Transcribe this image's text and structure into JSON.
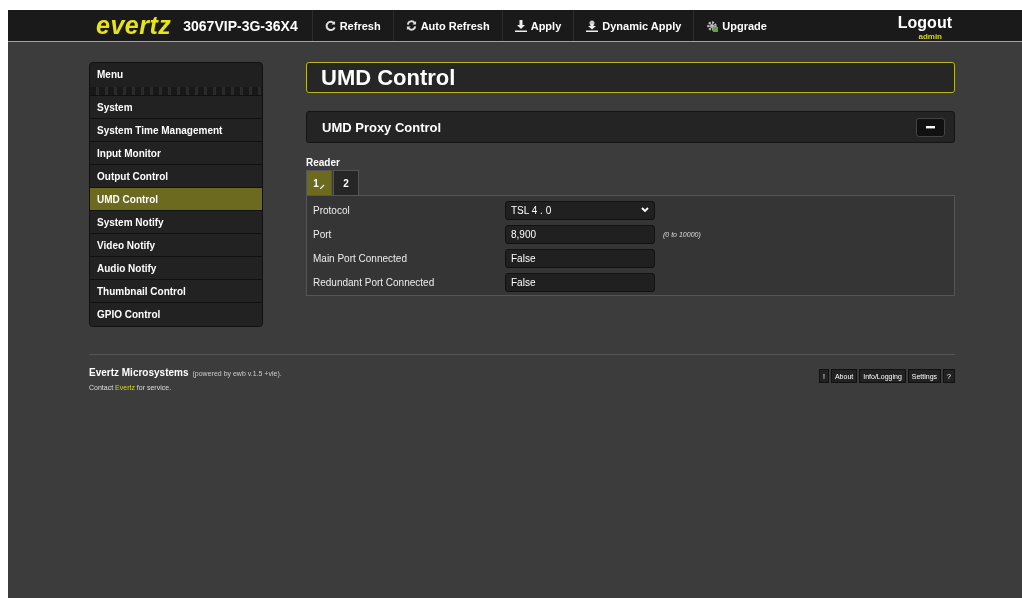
{
  "header": {
    "logo": "evertz",
    "device": "3067VIP-3G-36X4",
    "actions": [
      {
        "label": "Refresh",
        "kind": "refresh"
      },
      {
        "label": "Auto Refresh",
        "kind": "auto"
      },
      {
        "label": "Apply",
        "kind": "apply"
      },
      {
        "label": "Dynamic Apply",
        "kind": "dynamic"
      },
      {
        "label": "Upgrade",
        "kind": "upgrade"
      }
    ],
    "logout": "Logout",
    "user": "admin"
  },
  "sidebar": {
    "title": "Menu",
    "items": [
      {
        "label": "System",
        "selected": false
      },
      {
        "label": "System Time Management",
        "selected": false
      },
      {
        "label": "Input Monitor",
        "selected": false
      },
      {
        "label": "Output Control",
        "selected": false
      },
      {
        "label": "UMD Control",
        "selected": true
      },
      {
        "label": "System Notify",
        "selected": false
      },
      {
        "label": "Video Notify",
        "selected": false
      },
      {
        "label": "Audio Notify",
        "selected": false
      },
      {
        "label": "Thumbnail Control",
        "selected": false
      },
      {
        "label": "GPIO Control",
        "selected": false
      }
    ]
  },
  "page_title": "UMD Control",
  "section": {
    "title": "UMD Proxy Control",
    "expanded": true,
    "group_label": "Reader",
    "tabs": [
      {
        "label": "1",
        "selected": true
      },
      {
        "label": "2",
        "selected": false
      }
    ],
    "fields": [
      {
        "label": "Protocol",
        "kind": "select",
        "value": "TSL 4 . 0"
      },
      {
        "label": "Port",
        "kind": "input",
        "value": "8,900",
        "hint": "(0 to 10000)"
      },
      {
        "label": "Main Port Connected",
        "kind": "readonly",
        "value": "False"
      },
      {
        "label": "Redundant Port Connected",
        "kind": "readonly",
        "value": "False"
      }
    ]
  },
  "footer": {
    "company": "Evertz Microsystems",
    "powered": "(powered by ewb v.1.5 +vle).",
    "contact_before": "Contact",
    "contact_link": "Evertz",
    "contact_after": "for service.",
    "links": [
      "!",
      "About",
      "Info/Logging",
      "Settings",
      "?"
    ]
  }
}
